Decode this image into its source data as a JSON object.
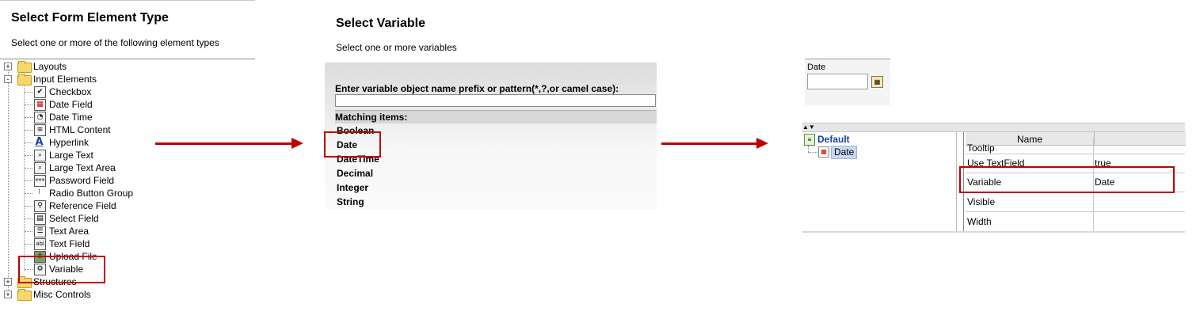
{
  "panel_element_type": {
    "title": "Select Form Element Type",
    "subtitle": "Select one or more of the following element types",
    "tree": [
      {
        "label": "Layouts",
        "type": "folder",
        "expander": "+"
      },
      {
        "label": "Input Elements",
        "type": "folder",
        "expander": "-"
      },
      {
        "label": "Checkbox",
        "icon": "checkbox-icon"
      },
      {
        "label": "Date Field",
        "icon": "date-field-icon"
      },
      {
        "label": "Date Time",
        "icon": "date-time-icon"
      },
      {
        "label": "HTML Content",
        "icon": "html-content-icon"
      },
      {
        "label": "Hyperlink",
        "icon": "hyperlink-icon"
      },
      {
        "label": "Large Text",
        "icon": "large-text-icon"
      },
      {
        "label": "Large Text Area",
        "icon": "large-text-area-icon"
      },
      {
        "label": "Password Field",
        "icon": "password-field-icon"
      },
      {
        "label": "Radio Button Group",
        "icon": "radio-button-group-icon"
      },
      {
        "label": "Reference Field",
        "icon": "reference-field-icon"
      },
      {
        "label": "Select Field",
        "icon": "select-field-icon"
      },
      {
        "label": "Text Area",
        "icon": "text-area-icon"
      },
      {
        "label": "Text Field",
        "icon": "text-field-icon"
      },
      {
        "label": "Upload File",
        "icon": "upload-file-icon"
      },
      {
        "label": "Variable",
        "icon": "variable-icon",
        "highlighted": true
      },
      {
        "label": "Structures",
        "type": "folder",
        "expander": "+"
      },
      {
        "label": "Misc Controls",
        "type": "folder",
        "expander": "+"
      }
    ]
  },
  "panel_variable": {
    "title": "Select Variable",
    "subtitle": "Select one or more variables",
    "prefix_label": "Enter variable object name prefix or pattern(*,?,or camel case):",
    "prefix_value": "",
    "matching_label": "Matching items:",
    "items": [
      "Boolean",
      "Date",
      "DateTime",
      "Decimal",
      "Integer",
      "String"
    ],
    "highlighted_item": "Date"
  },
  "panel_properties": {
    "preview_label": "Date",
    "preview_value": "",
    "tree_root": "Default",
    "tree_child": "Date",
    "grid_header_name": "Name",
    "rows": [
      {
        "name": "Tooltip",
        "value": ""
      },
      {
        "name": "Use TextField",
        "value": "true"
      },
      {
        "name": "Variable",
        "value": "Date",
        "highlighted": true
      },
      {
        "name": "Visible",
        "value": ""
      },
      {
        "name": "Width",
        "value": ""
      }
    ]
  },
  "colors": {
    "highlight_red": "#c00000",
    "tree_link_blue": "#1a3fa0",
    "selection_bg": "#c9d7f2"
  }
}
